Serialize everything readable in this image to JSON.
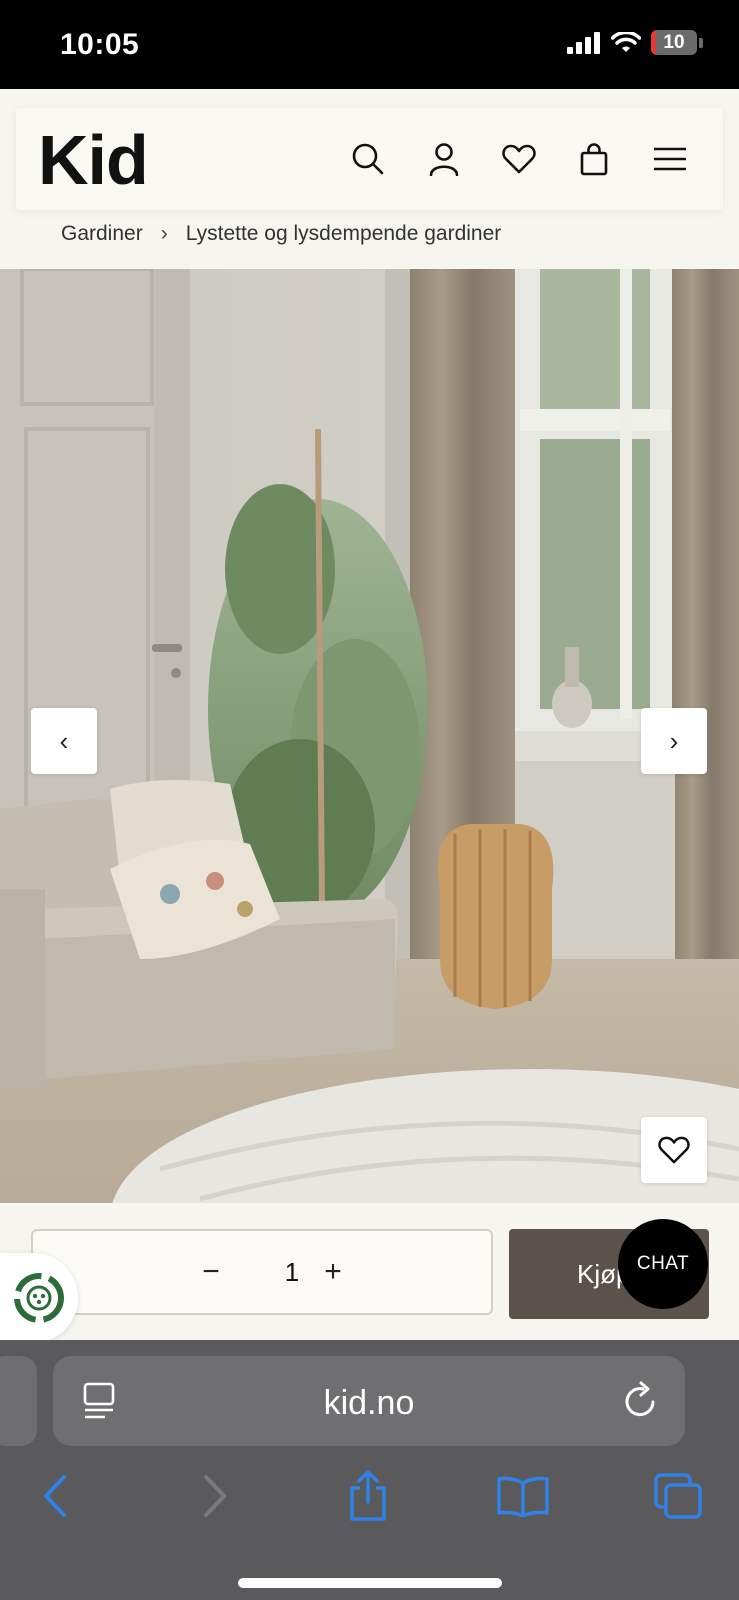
{
  "status_bar": {
    "time": "10:05",
    "battery": "10"
  },
  "header": {
    "logo": "Kid",
    "icons": [
      "search-icon",
      "account-icon",
      "heart-icon",
      "cart-icon",
      "menu-icon"
    ]
  },
  "breadcrumb": {
    "items": [
      "Gardiner",
      "Lystette og lysdempende gardiner"
    ],
    "separator": "›"
  },
  "hero": {
    "prev_label": "‹",
    "next_label": "›"
  },
  "purchase": {
    "minus": "−",
    "quantity": "1",
    "plus": "+",
    "buy_label": "Kjøp",
    "chat_label": "CHAT"
  },
  "browser": {
    "url": "kid.no"
  },
  "colors": {
    "buy_button": "#5c524c",
    "chat": "#000000",
    "eco_green": "#2e6b3a",
    "safari_blue": "#2f82e6"
  }
}
